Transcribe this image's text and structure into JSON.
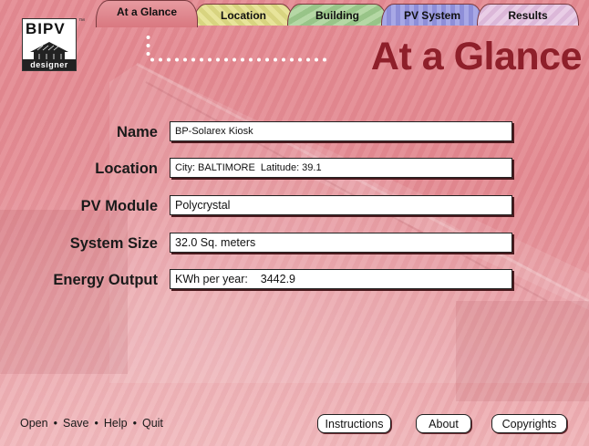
{
  "tabs": [
    {
      "label": "At a Glance"
    },
    {
      "label": "Location"
    },
    {
      "label": "Building"
    },
    {
      "label": "PV System"
    },
    {
      "label": "Results"
    }
  ],
  "logo": {
    "text": "BIPV",
    "tm": "™",
    "sub": "designer"
  },
  "page_title": "At a Glance",
  "form": {
    "name": {
      "label": "Name",
      "value": "BP-Solarex Kiosk"
    },
    "location": {
      "label": "Location",
      "value": "City: BALTIMORE  Latitude: 39.1"
    },
    "pv_module": {
      "label": "PV Module",
      "value": "Polycrystal"
    },
    "system_size": {
      "label": "System Size",
      "value": "32.0 Sq. meters"
    },
    "energy_output": {
      "label": "Energy Output",
      "value": "KWh per year:    3442.9"
    }
  },
  "footer": {
    "links": [
      "Open",
      "Save",
      "Help",
      "Quit"
    ],
    "separator": "•",
    "buttons": {
      "instructions": "Instructions",
      "about": "About",
      "copyrights": "Copyrights"
    }
  },
  "colors": {
    "title": "#8e1f2a",
    "background": "#e48c94"
  }
}
